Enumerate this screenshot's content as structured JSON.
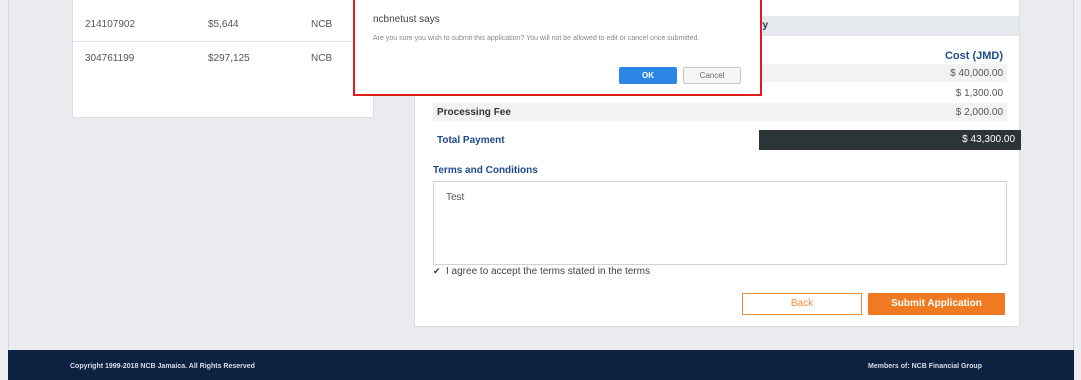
{
  "accounts": {
    "rows": [
      {
        "number": "214107902",
        "amount": "$5,644",
        "bank": "NCB"
      },
      {
        "number": "304761199",
        "amount": "$297,125",
        "bank": "NCB"
      }
    ]
  },
  "summary": {
    "header_partial": "ary",
    "cost_header": "Cost (JMD)",
    "fees": [
      {
        "label": "",
        "amount": "$ 40,000.00"
      },
      {
        "label": "",
        "amount": "$ 1,300.00"
      },
      {
        "label": "Processing Fee",
        "amount": "$ 2,000.00"
      }
    ],
    "total_label": "Total Payment",
    "total_amount": "$ 43,300.00",
    "terms_title": "Terms and Conditions",
    "terms_text": "Test",
    "agree_check": "✔",
    "agree_label": "I agree to accept the terms stated in the terms",
    "back_label": "Back",
    "submit_label": "Submit Application"
  },
  "dialog": {
    "title": "ncbnetust says",
    "message": "Are you sure you wish to submit this application? You will not be allowed to edit or cancel once submitted.",
    "ok_label": "OK",
    "cancel_label": "Cancel"
  },
  "footer": {
    "copyright": "Copyright 1999-2018 NCB Jamaica. All Rights Reserved",
    "members": "Members of: NCB Financial Group"
  },
  "colors": {
    "accent_orange": "#f07a22",
    "navy": "#0c2240",
    "dialog_border": "#e21b1b",
    "ok_blue": "#2c86e6"
  }
}
